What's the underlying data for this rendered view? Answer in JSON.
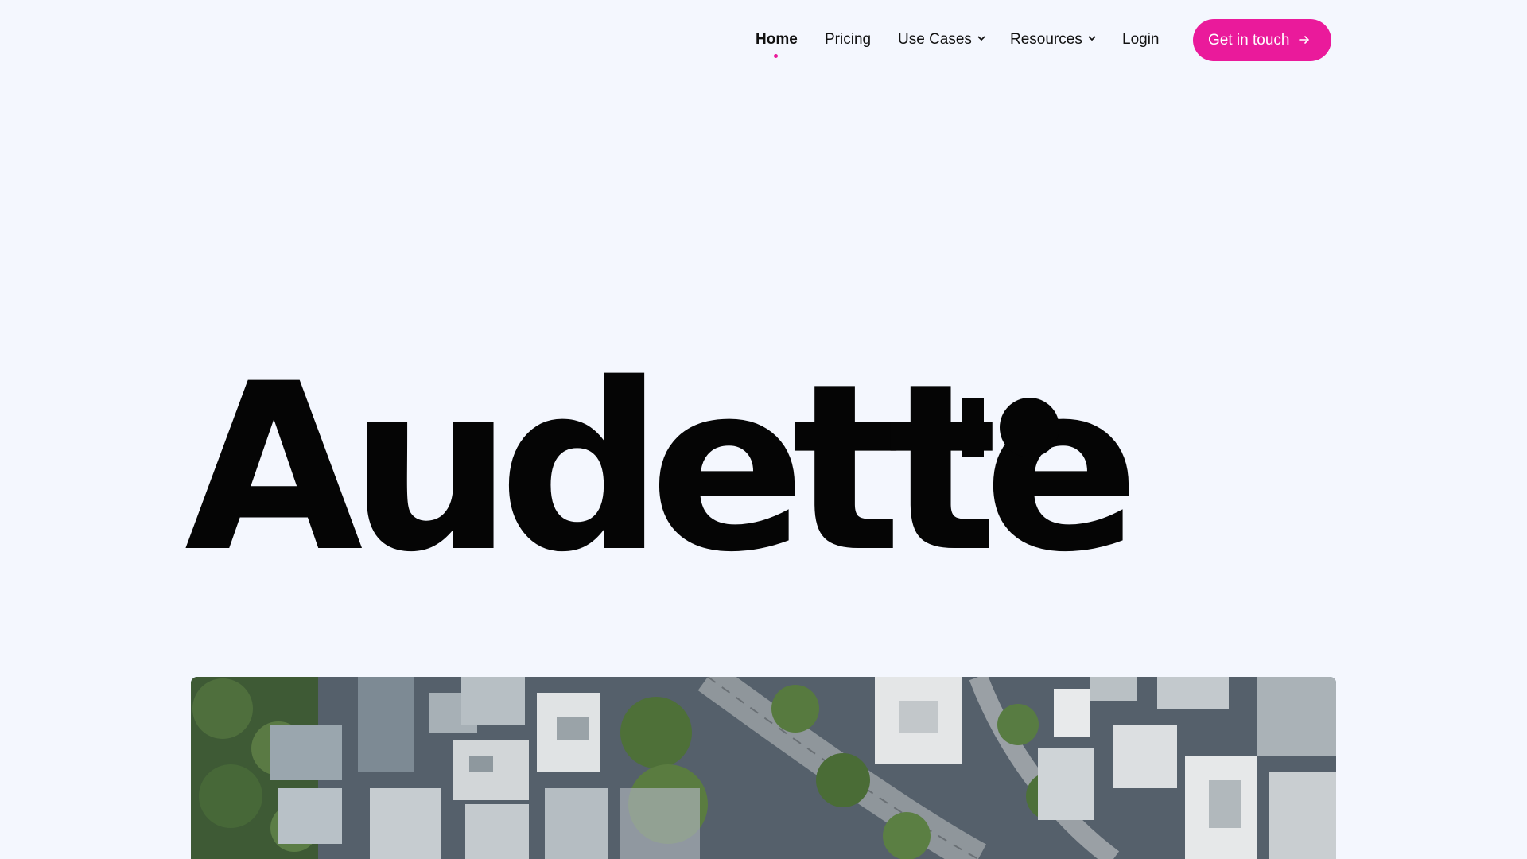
{
  "nav": {
    "items": [
      {
        "label": "Home",
        "active": true
      },
      {
        "label": "Pricing"
      },
      {
        "label": "Use Cases",
        "has_dropdown": true
      },
      {
        "label": "Resources",
        "has_dropdown": true
      },
      {
        "label": "Login"
      }
    ],
    "cta_label": "Get in touch",
    "cta_icon": "arrow-right-icon"
  },
  "logo": {
    "wordmark": "Audette",
    "mark": "bar-and-dot"
  },
  "hero": {
    "image_subject": "aerial view of city blocks and curved road"
  },
  "colors": {
    "background": "#f4f7fe",
    "accent": "#ea1a9b",
    "text": "#0a0a0a"
  }
}
